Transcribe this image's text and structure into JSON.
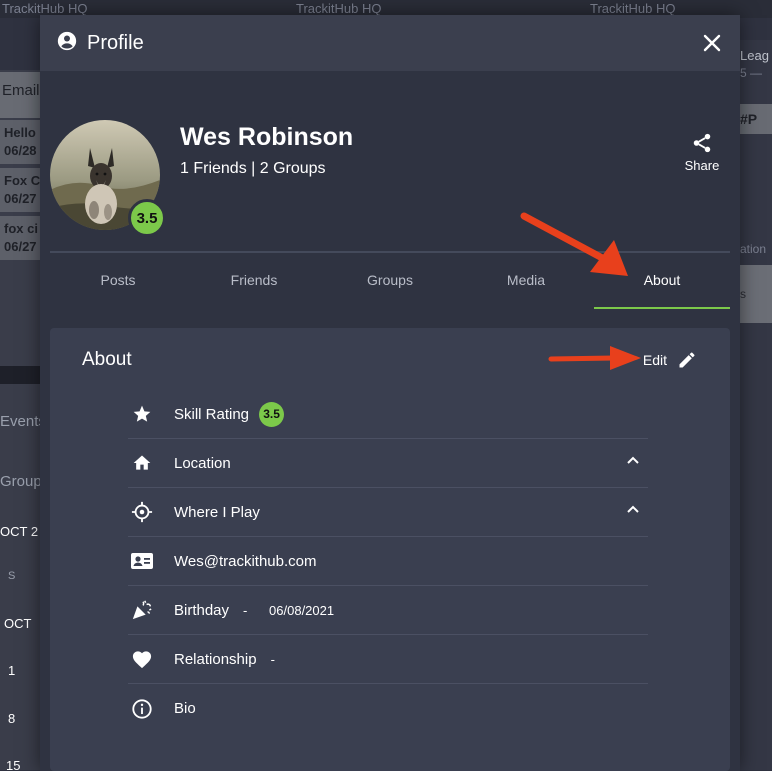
{
  "background": {
    "top_tabs": [
      "TrackitHub HQ",
      "TrackitHub HQ",
      "TrackitHub HQ"
    ],
    "email_label": "Email",
    "messages": [
      {
        "title": "Hello",
        "date": "06/28"
      },
      {
        "title": "Fox C",
        "date": "06/27"
      },
      {
        "title": "fox ci",
        "date": "06/27"
      }
    ],
    "sidebar": [
      "Events",
      "Group",
      "OCT 2",
      "S",
      "OCT",
      "1",
      "8",
      "15"
    ],
    "right_texts": [
      "Leag",
      "5 —",
      "#P",
      "ation",
      "s"
    ]
  },
  "modal": {
    "title": "Profile",
    "close_icon": "close-icon",
    "profile": {
      "name": "Wes Robinson",
      "stats": "1 Friends | 2 Groups",
      "rating": "3.5",
      "share_label": "Share"
    },
    "tabs": [
      {
        "label": "Posts",
        "active": false
      },
      {
        "label": "Friends",
        "active": false
      },
      {
        "label": "Groups",
        "active": false
      },
      {
        "label": "Media",
        "active": false
      },
      {
        "label": "About",
        "active": true
      }
    ],
    "about": {
      "title": "About",
      "edit_label": "Edit",
      "rows": [
        {
          "icon": "star-icon",
          "label": "Skill Rating",
          "badge": "3.5"
        },
        {
          "icon": "home-icon",
          "label": "Location",
          "expand": "chevron-up-icon"
        },
        {
          "icon": "target-icon",
          "label": "Where I Play",
          "expand": "chevron-up-icon"
        },
        {
          "icon": "contact-card-icon",
          "label": "Wes@trackithub.com"
        },
        {
          "icon": "party-popper-icon",
          "label": "Birthday",
          "value": "-      06/08/2021"
        },
        {
          "icon": "heart-icon",
          "label": "Relationship",
          "value": "-"
        },
        {
          "icon": "info-icon",
          "label": "Bio"
        }
      ]
    }
  },
  "colors": {
    "accent_green": "#7cc94a",
    "annotation_arrow": "#e8401c",
    "modal_bg": "#2f3341",
    "card_bg": "#3a3f50"
  }
}
